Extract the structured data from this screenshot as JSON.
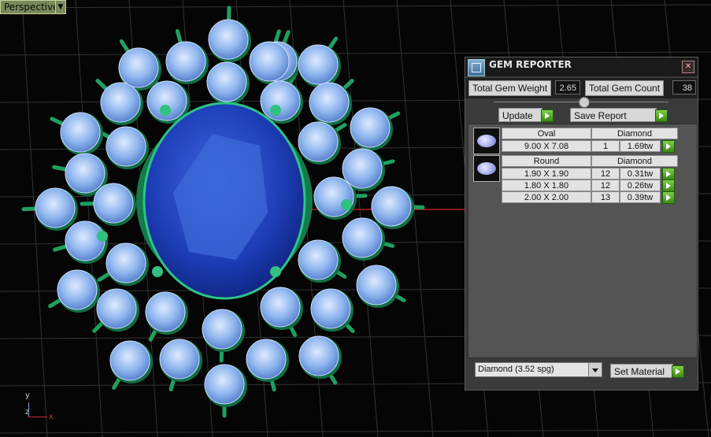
{
  "viewport": {
    "label": "Perspective",
    "axis_y": "y",
    "axis_z": "z",
    "axis_x": "x"
  },
  "panel": {
    "title": "GEM REPORTER",
    "total_weight_label": "Total Gem Weight",
    "total_weight_value": "2.65",
    "total_count_label": "Total Gem Count",
    "total_count_value": "38",
    "update_label": "Update",
    "save_label": "Save Report",
    "groups": [
      {
        "shape": "Oval",
        "material": "Diamond",
        "icon": "oval-gem-icon",
        "rows": [
          {
            "size": "9.00 X 7.08",
            "count": "1",
            "weight": "1.69tw"
          }
        ]
      },
      {
        "shape": "Round",
        "material": "Diamond",
        "icon": "round-gem-icon",
        "rows": [
          {
            "size": "1.90 X 1.90",
            "count": "12",
            "weight": "0.31tw"
          },
          {
            "size": "1.80 X 1.80",
            "count": "12",
            "weight": "0.26tw"
          },
          {
            "size": "2.00 X 2.00",
            "count": "13",
            "weight": "0.39tw"
          }
        ]
      }
    ],
    "material_select": "Diamond     (3.52 spg)",
    "set_material_label": "Set Material"
  },
  "colors": {
    "gem_blue": "#1c3cb4",
    "diamond": "#8fb8f0",
    "prong": "#1fa060"
  }
}
